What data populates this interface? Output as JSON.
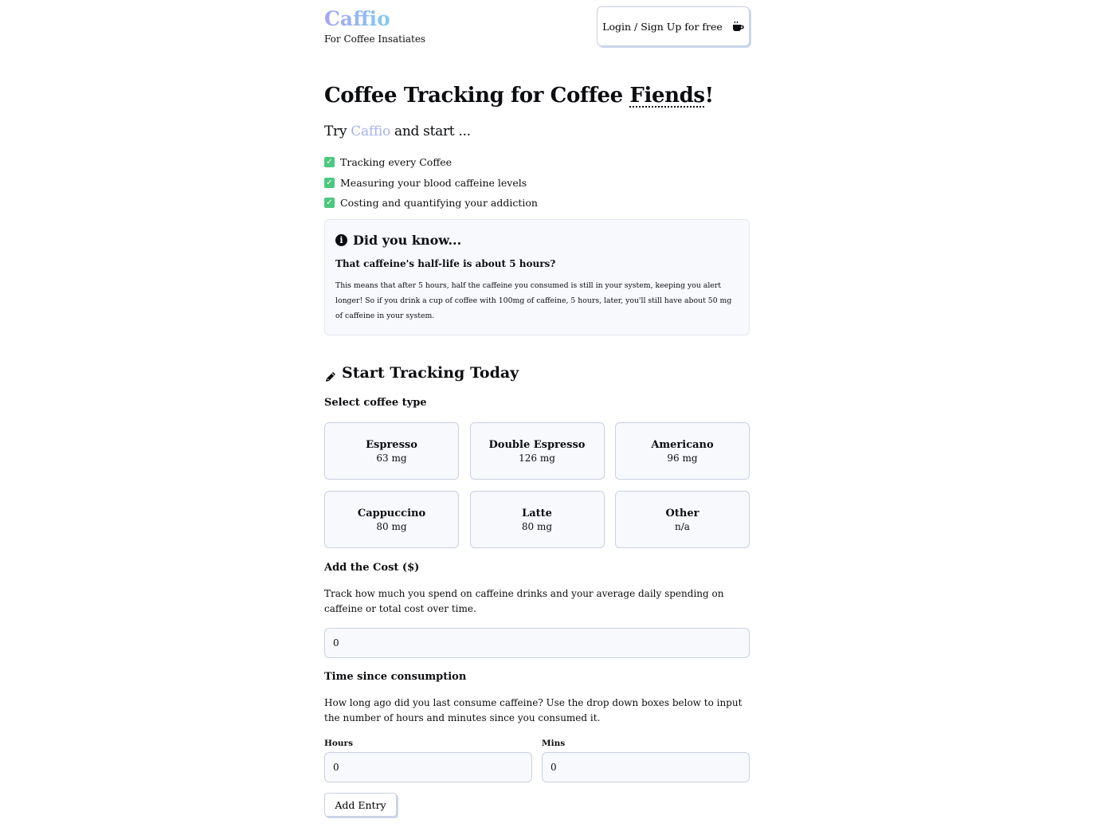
{
  "header": {
    "logo": "Caffio",
    "tagline": "For Coffee Insatiates",
    "login_label": "Login / Sign Up for free",
    "login_icon": "coffee-cup-icon"
  },
  "hero": {
    "title_prefix": "Coffee Tracking for Coffee ",
    "title_emphasis": "Fiends",
    "title_suffix": "!",
    "sub_prefix": "Try ",
    "sub_brand": "Caffio",
    "sub_suffix": " and start ..."
  },
  "features": [
    "Tracking every Coffee",
    "Measuring your blood caffeine levels",
    "Costing and quantifying your addiction"
  ],
  "info": {
    "title": "Did you know...",
    "question": "That caffeine's half-life is about 5 hours?",
    "text": "This means that after 5 hours, half the caffeine you consumed is still in your system, keeping you alert longer! So if you drink a cup of coffee with 100mg of caffeine, 5 hours, later, you'll still have about 50 mg of caffeine in your system."
  },
  "tracking": {
    "title": "Start Tracking Today",
    "select_label": "Select coffee type",
    "coffee_types": [
      {
        "name": "Espresso",
        "mg": "63 mg"
      },
      {
        "name": "Double Espresso",
        "mg": "126 mg"
      },
      {
        "name": "Americano",
        "mg": "96 mg"
      },
      {
        "name": "Cappuccino",
        "mg": "80 mg"
      },
      {
        "name": "Latte",
        "mg": "80 mg"
      },
      {
        "name": "Other",
        "mg": "n/a"
      }
    ],
    "cost_label": "Add the Cost ($)",
    "cost_text": "Track how much you spend on caffeine drinks and your average daily spending on caffeine or total cost over time.",
    "cost_value": "0",
    "time_label": "Time since consumption",
    "time_text": "How long ago did you last consume caffeine? Use the drop down boxes below to input the number of hours and minutes since you consumed it.",
    "hours_label": "Hours",
    "hours_value": "0",
    "mins_label": "Mins",
    "mins_value": "0",
    "add_button": "Add Entry"
  },
  "colors": {
    "brand_start": "#a7a2f7",
    "brand_end": "#82cbf2",
    "check": "#4cc87f"
  }
}
